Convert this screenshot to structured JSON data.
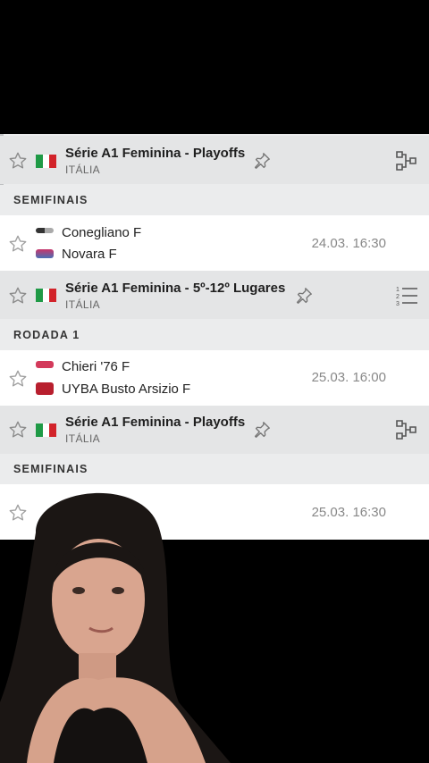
{
  "sections": [
    {
      "league": "Série A1 Feminina - Playoffs",
      "country": "ITÁLIA",
      "tool_icon": "bracket-icon",
      "round": "SEMIFINAIS",
      "match": {
        "home": "Conegliano F",
        "away": "Novara F",
        "time": "24.03. 16:30"
      }
    },
    {
      "league": "Série A1 Feminina - 5º-12º Lugares",
      "country": "ITÁLIA",
      "tool_icon": "standings-list-icon",
      "round": "RODADA 1",
      "match": {
        "home": "Chieri '76 F",
        "away": "UYBA Busto Arsizio F",
        "time": "25.03. 16:00"
      }
    },
    {
      "league": "Série A1 Feminina - Playoffs",
      "country": "ITÁLIA",
      "tool_icon": "bracket-icon",
      "round": "SEMIFINAIS",
      "match": {
        "home": "",
        "away": "",
        "time": "25.03. 16:30"
      }
    }
  ],
  "colors": {
    "italy_green": "#1f9a46",
    "italy_white": "#ffffff",
    "italy_red": "#d2232a",
    "panel_bg": "#ebeced",
    "league_bg": "#e4e5e6",
    "match_bg": "#ffffff"
  }
}
